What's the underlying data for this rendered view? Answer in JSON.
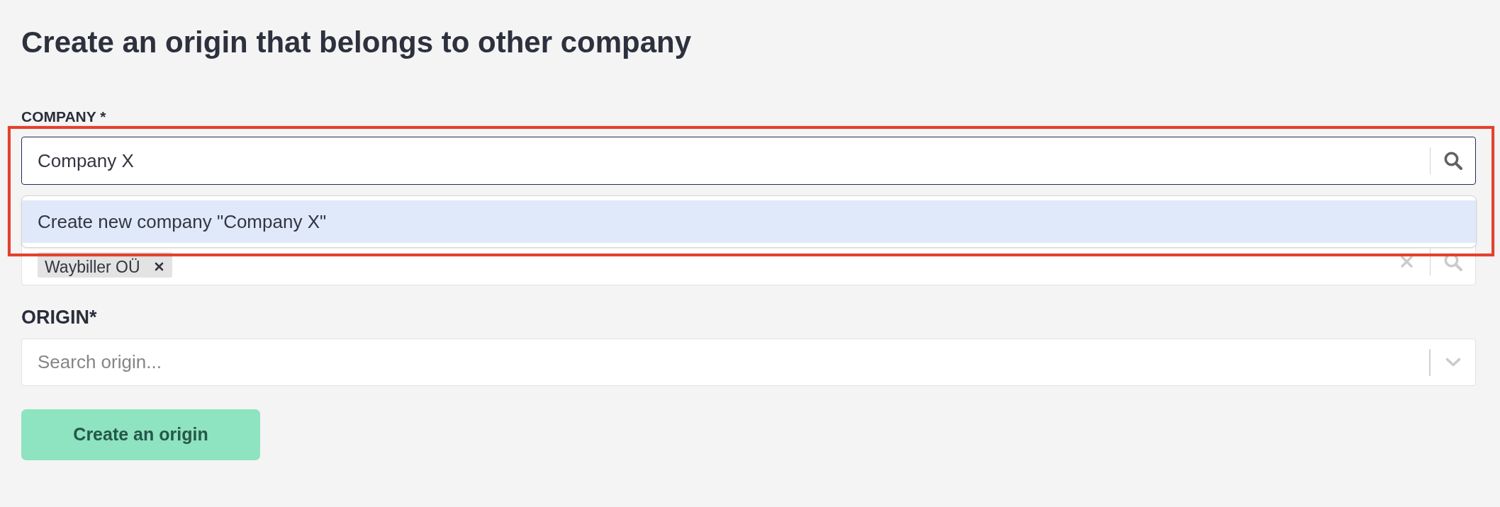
{
  "page": {
    "title": "Create an origin that belongs to other company"
  },
  "fields": [
    {
      "kind": "search",
      "label": "COMPANY *",
      "value": "Company X",
      "focused": true,
      "highlighted": true,
      "menu": [
        {
          "label": "Create new company \"Company X\"",
          "selected": true
        }
      ]
    },
    {
      "kind": "tags",
      "focused": false,
      "highlighted": false,
      "tags": [
        {
          "label": "Waybiller OÜ"
        }
      ]
    },
    {
      "kind": "select",
      "label": "ORIGIN*",
      "placeholder": "Search origin...",
      "focused": false,
      "highlighted": false
    }
  ],
  "submit_button": {
    "label": "Create an origin"
  }
}
